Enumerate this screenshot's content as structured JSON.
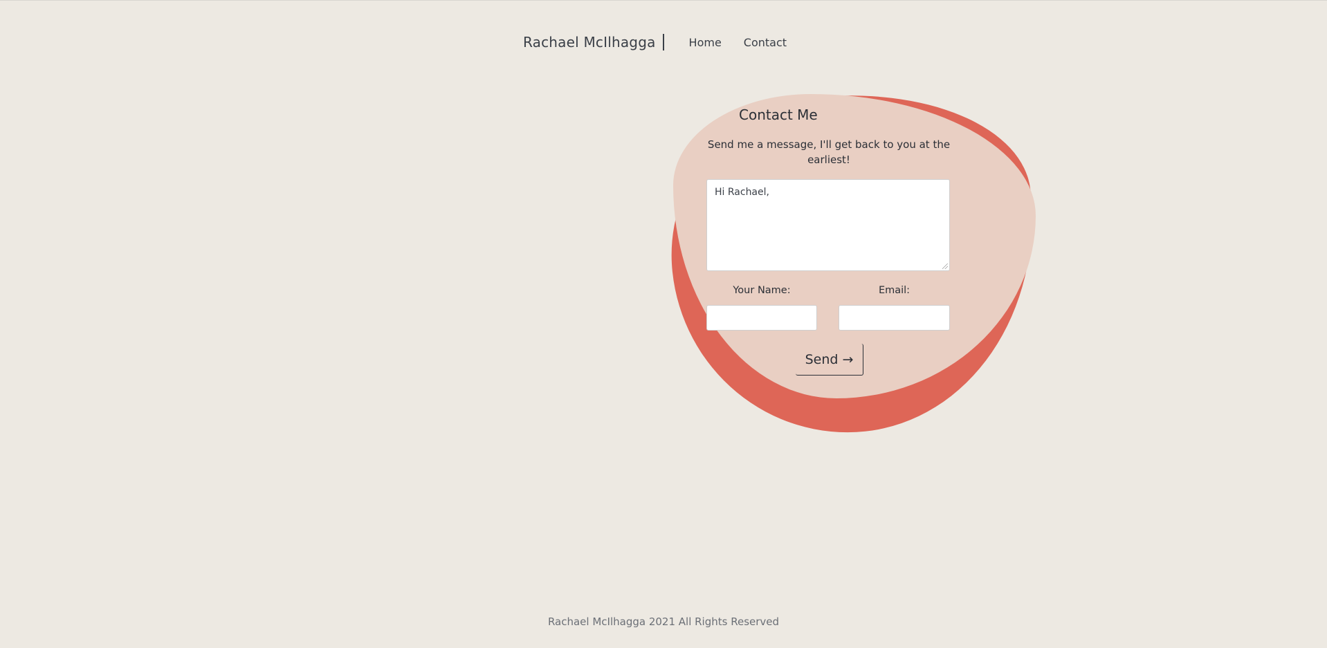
{
  "header": {
    "brand": "Rachael McIlhagga",
    "nav": [
      {
        "label": "Home"
      },
      {
        "label": "Contact"
      }
    ]
  },
  "contact": {
    "title": "Contact Me",
    "subtitle": "Send me a message, I'll get back to you at the earliest!",
    "message_value": "Hi Rachael,",
    "name_label": "Your Name:",
    "email_label": "Email:",
    "name_value": "",
    "email_value": "",
    "send_label": "Send →"
  },
  "footer": {
    "text": "Rachael McIlhagga 2021 All Rights Reserved"
  },
  "colors": {
    "background": "#ede9e2",
    "blob_accent": "#de6657",
    "blob_light": "#e9cfc3",
    "text": "#2b2f36"
  }
}
